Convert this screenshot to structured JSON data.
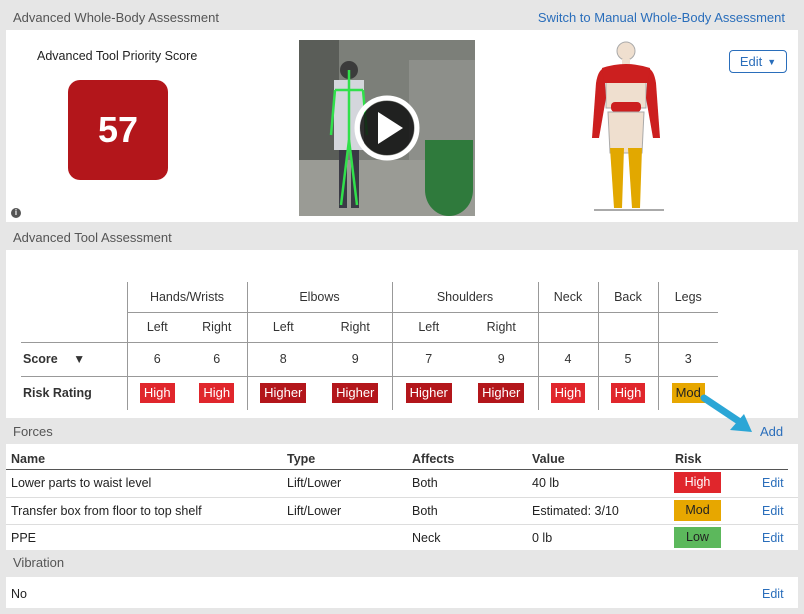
{
  "wba": {
    "title": "Advanced Whole-Body Assessment",
    "switch_link": "Switch to Manual Whole-Body Assessment",
    "priority_label": "Advanced Tool Priority Score",
    "priority_score": "57",
    "edit_label": "Edit",
    "info_icon": "info-icon",
    "video_icon": "play-icon"
  },
  "ata": {
    "title": "Advanced Tool Assessment",
    "groups": [
      "Hands/Wrists",
      "Elbows",
      "Shoulders",
      "Neck",
      "Back",
      "Legs"
    ],
    "sides": [
      "Left",
      "Right",
      "Left",
      "Right",
      "Left",
      "Right"
    ],
    "score_label": "Score",
    "risk_label": "Risk Rating",
    "scores": [
      "6",
      "6",
      "8",
      "9",
      "7",
      "9",
      "4",
      "5",
      "3"
    ],
    "ratings": [
      "High",
      "High",
      "Higher",
      "Higher",
      "Higher",
      "Higher",
      "High",
      "High",
      "Mod"
    ]
  },
  "forces": {
    "title": "Forces",
    "add_label": "Add",
    "columns": [
      "Name",
      "Type",
      "Affects",
      "Value",
      "Risk"
    ],
    "rows": [
      {
        "name": "Lower parts to waist level",
        "type": "Lift/Lower",
        "affects": "Both",
        "value": "40 lb",
        "risk": "High",
        "edit": "Edit"
      },
      {
        "name": "Transfer box from floor to top shelf",
        "type": "Lift/Lower",
        "affects": "Both",
        "value": "Estimated: 3/10",
        "risk": "Mod",
        "edit": "Edit"
      },
      {
        "name": "PPE",
        "type": "",
        "affects": "Neck",
        "value": "0 lb",
        "risk": "Low",
        "edit": "Edit"
      }
    ]
  },
  "vibration": {
    "title": "Vibration",
    "value": "No",
    "edit": "Edit"
  },
  "colors": {
    "high": "#e0262c",
    "higher": "#b3161b",
    "mod": "#e7a700",
    "low": "#5cb85c",
    "link": "#2a6ebb"
  }
}
